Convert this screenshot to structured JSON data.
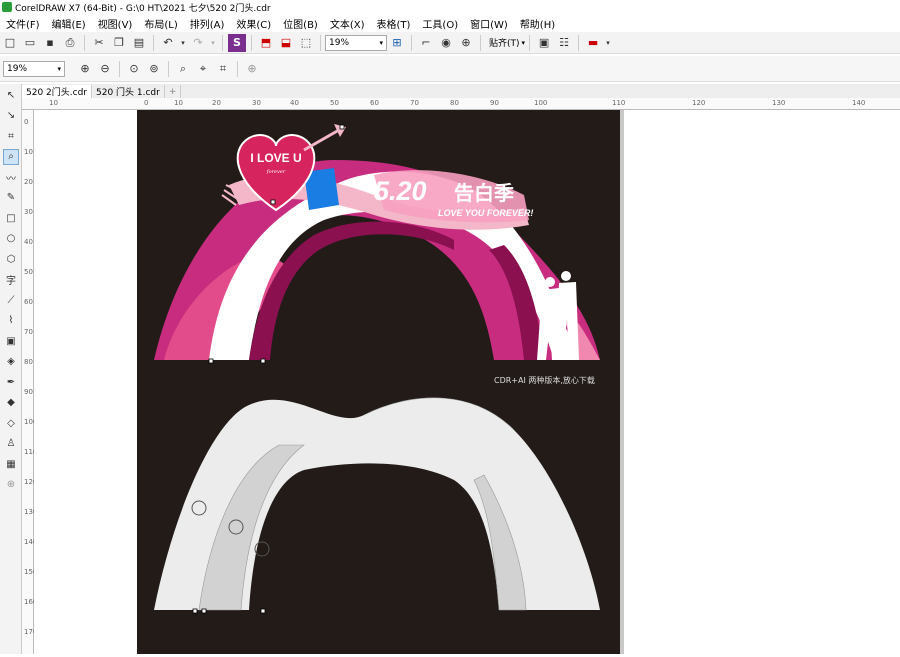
{
  "window": {
    "title": "CorelDRAW X7 (64-Bit) - G:\\0 HT\\2021 七夕\\520 2门头.cdr"
  },
  "menu": [
    "文件(F)",
    "编辑(E)",
    "视图(V)",
    "布局(L)",
    "排列(A)",
    "效果(C)",
    "位图(B)",
    "文本(X)",
    "表格(T)",
    "工具(O)",
    "窗口(W)",
    "帮助(H)"
  ],
  "toolbar": {
    "zoom_value": "19%",
    "snap_label": "贴齐(T)"
  },
  "propbar": {
    "zoom_value": "19%"
  },
  "tabs": [
    {
      "label": "520 2门头.cdr"
    },
    {
      "label": "520 门头 1.cdr"
    }
  ],
  "ruler": {
    "h": [
      "10",
      "0",
      "10",
      "20",
      "30",
      "40",
      "50",
      "60",
      "70",
      "80",
      "90",
      "100",
      "110",
      "120",
      "130",
      "140"
    ],
    "v": [
      "0",
      "10",
      "20",
      "30",
      "40",
      "50",
      "60",
      "70",
      "80",
      "90",
      "100",
      "110",
      "120",
      "130",
      "140",
      "150",
      "160",
      "170"
    ]
  },
  "artwork": {
    "heart_text": "I LOVE U",
    "heart_script": "forever",
    "title_520": "5.20",
    "title_cn": "告白季",
    "subtitle": "LOVE YOU FOREVER!",
    "note": "CDR+AI 两种版本,放心下载"
  },
  "colors": {
    "bg": "#221b18",
    "pink_dark": "#c72c7f",
    "pink_mid": "#e24c8a",
    "pink_light": "#f4b7c9",
    "blue": "#1a7de3",
    "gray_white": "#ececec"
  }
}
